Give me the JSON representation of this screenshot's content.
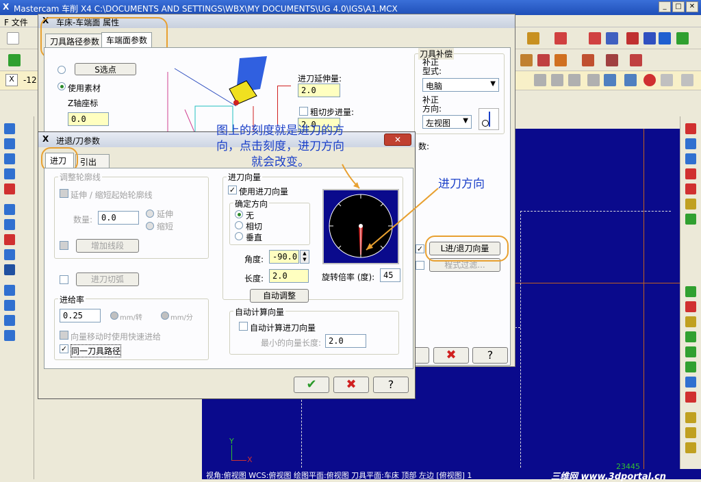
{
  "app": {
    "title": "Mastercam 车削  X4  C:\\DOCUMENTS AND SETTINGS\\WBX\\MY DOCUMENTS\\UG 4.0\\IGS\\A1.MCX",
    "menu_file": "F 文件",
    "coord_field": "-12"
  },
  "dialog1": {
    "title": "车床-车端面 属性",
    "tab_toolpath": "刀具路径参数",
    "tab_face": "车端面参数",
    "select_point_btn": "S选点",
    "use_stock_label": "使用素材",
    "z_coord_label": "Z轴座标",
    "z_coord_value": "0.0",
    "entry_ext_label": "进刀延伸量:",
    "entry_ext_value": "2.0",
    "rough_step_label": "粗切步进量:",
    "rough_step_value": "2.0",
    "comp_group_title": "刀具补偿",
    "comp_type_label": "补正\n型式:",
    "comp_type_value": "电脑",
    "comp_dir_label": "补正\n方向:",
    "comp_dir_value": "左视图",
    "partial_label": "数:",
    "lead_in_out_btn": "L进/退刀向量",
    "program_filter_btn": "程式过滤..."
  },
  "dialog2": {
    "title": "进退/刀参数",
    "tab_in": "进刀",
    "tab_out": "引出",
    "adjust_contour_group": "调整轮廓线",
    "extend_shorten_chk": "延伸 / 缩短起始轮廓线",
    "amount_label": "数量:",
    "amount_value": "0.0",
    "extend_radio": "延伸",
    "shorten_radio": "缩短",
    "add_line_btn": "增加线段",
    "entry_arc_btn": "进刀切弧",
    "feed_group": "进给率",
    "feed_value": "0.25",
    "per_rev": "mm/转",
    "per_min": "mm/分",
    "rapid_chk": "向量移动时使用快速进给",
    "same_path_chk": "同一刀具路径",
    "entry_vector_group": "进刀向量",
    "use_vector_chk": "使用进刀向量",
    "direction_group": "确定方向",
    "dir_none": "无",
    "dir_tangent": "相切",
    "dir_vertical": "垂直",
    "angle_label": "角度:",
    "angle_value": "-90.0",
    "length_label": "长度:",
    "length_value": "2.0",
    "auto_adjust_btn": "自动调整",
    "rotate_label": "旋转倍率 (度):",
    "rotate_value": "45",
    "auto_vector_group": "自动计算向量",
    "auto_calc_chk": "自动计算进刀向量",
    "min_len_label": "最小的向量长度:",
    "min_len_value": "2.0"
  },
  "annotations": {
    "main_note": "图上的刻度就是进刀的方\n向，点击刻度，进刀方向\n就会改变。",
    "dir_note": "进刀方向"
  },
  "status": {
    "text": "视角:俯视图    WCS:俯视图    绘图平面:俯视图    刀具平面:车床 顶部 左边 [俯视图] 1",
    "coord": "23445",
    "watermark": "三维网 www.3dportal.cn"
  }
}
